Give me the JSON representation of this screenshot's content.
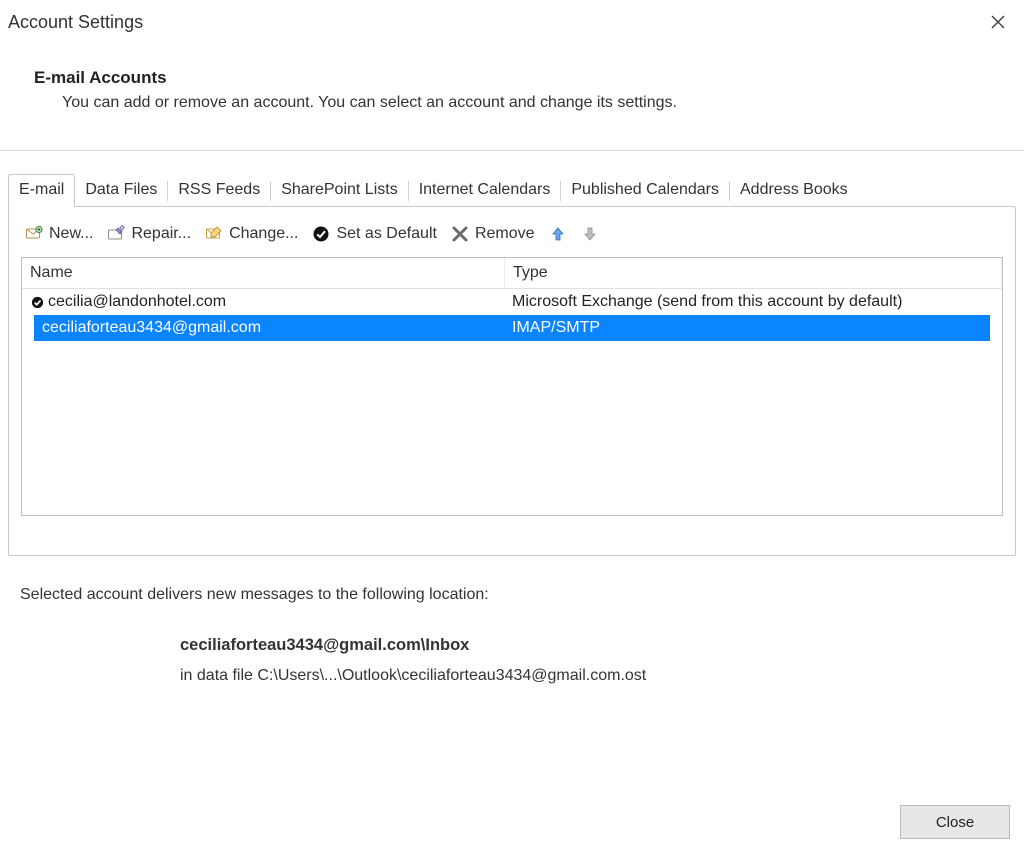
{
  "window": {
    "title": "Account Settings"
  },
  "header": {
    "heading": "E-mail Accounts",
    "subheading": "You can add or remove an account. You can select an account and change its settings."
  },
  "tabs": {
    "items": [
      {
        "label": "E-mail",
        "active": true
      },
      {
        "label": "Data Files"
      },
      {
        "label": "RSS Feeds"
      },
      {
        "label": "SharePoint Lists"
      },
      {
        "label": "Internet Calendars"
      },
      {
        "label": "Published Calendars"
      },
      {
        "label": "Address Books"
      }
    ]
  },
  "toolbar": {
    "new_label": "New...",
    "repair_label": "Repair...",
    "change_label": "Change...",
    "default_label": "Set as Default",
    "remove_label": "Remove"
  },
  "accounts": {
    "columns": {
      "name": "Name",
      "type": "Type"
    },
    "rows": [
      {
        "name": "cecilia@landonhotel.com",
        "type": "Microsoft Exchange (send from this account by default)",
        "default": true,
        "selected": false
      },
      {
        "name": "ceciliaforteau3434@gmail.com",
        "type": "IMAP/SMTP",
        "default": false,
        "selected": true
      }
    ]
  },
  "delivery": {
    "label": "Selected account delivers new messages to the following location:",
    "location": "ceciliaforteau3434@gmail.com\\Inbox",
    "datafile": "in data file C:\\Users\\...\\Outlook\\ceciliaforteau3434@gmail.com.ost"
  },
  "footer": {
    "close_label": "Close"
  }
}
